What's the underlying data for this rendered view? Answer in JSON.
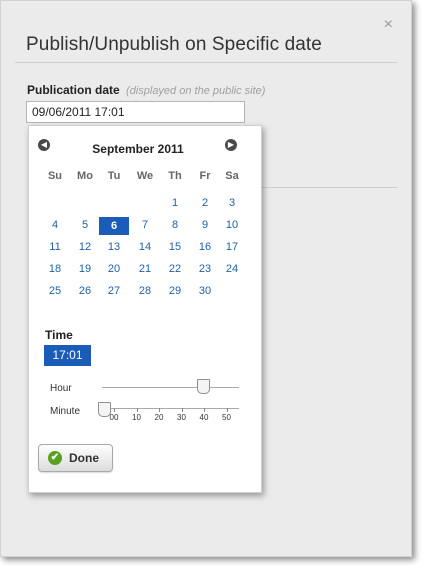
{
  "dialog": {
    "title": "Publish/Unpublish on Specific date",
    "close_glyph": "×"
  },
  "field": {
    "label": "Publication date",
    "hint": "(displayed on the public site)",
    "value": "09/06/2011 17:01"
  },
  "calendar": {
    "month_label": "September 2011",
    "prev_glyph": "◀",
    "next_glyph": "▶",
    "weekdays": [
      "Su",
      "Mo",
      "Tu",
      "We",
      "Th",
      "Fr",
      "Sa"
    ],
    "first_weekday_index": 4,
    "days_in_month": 30,
    "selected_day": 6
  },
  "time": {
    "label": "Time",
    "value": "17:01",
    "hour_label": "Hour",
    "minute_label": "Minute",
    "hour_value": 17,
    "hour_max": 23,
    "minute_value": 1,
    "minute_max": 59,
    "minute_ticks": [
      "00",
      "10",
      "20",
      "30",
      "40",
      "50"
    ]
  },
  "done_button": {
    "label": "Done",
    "icon": "checkmark-icon"
  },
  "colors": {
    "accent": "#1a5cb7",
    "link": "#1f5fa8",
    "done_icon": "#5aa021"
  }
}
